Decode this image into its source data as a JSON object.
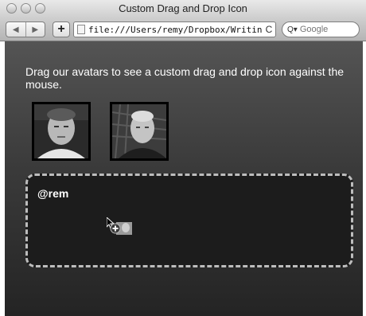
{
  "window": {
    "title": "Custom Drag and Drop Icon"
  },
  "toolbar": {
    "back_glyph": "◀",
    "forward_glyph": "▶",
    "add_bookmark_label": "+",
    "url": "file:///Users/remy/Dropbox/Writing/h",
    "reload_glyph": "C",
    "search_placeholder": "Google",
    "search_glyph": "Q▾"
  },
  "page": {
    "intro_text": "Drag our avatars to see a custom drag and drop icon against the mouse.",
    "avatars": [
      {
        "icon": "avatar-remy-photo"
      },
      {
        "icon": "avatar-bruce-photo"
      }
    ],
    "dropzone": {
      "label": "@rem"
    },
    "drag_ghost": {
      "icon": "custom-drag-icon"
    }
  },
  "colors": {
    "background_top": "#545454",
    "background_bottom": "#242424",
    "dropzone_bg": "#1c1c1c",
    "dropzone_border": "#bdbdbd",
    "text": "#ffffff"
  }
}
